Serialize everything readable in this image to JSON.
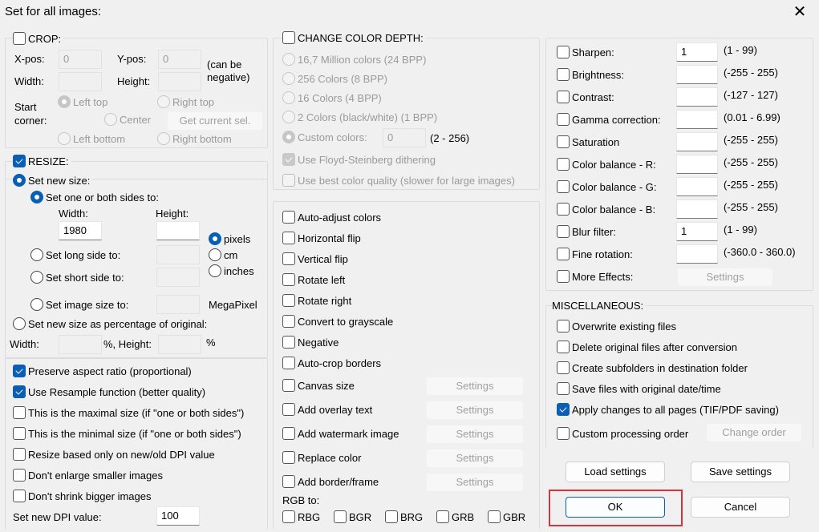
{
  "window": {
    "title": "Set for all images:",
    "close_icon": "close-icon"
  },
  "crop": {
    "label": "CROP:",
    "checked": false,
    "xpos_label": "X-pos:",
    "xpos_value": "0",
    "ypos_label": "Y-pos:",
    "ypos_value": "0",
    "can_be": "(can be",
    "negative": "negative)",
    "width_label": "Width:",
    "height_label": "Height:",
    "start_label1": "Start",
    "start_label2": "corner:",
    "left_top": "Left top",
    "right_top": "Right top",
    "center": "Center",
    "left_bottom": "Left bottom",
    "right_bottom": "Right bottom",
    "get_sel": "Get current sel."
  },
  "resize": {
    "label": "RESIZE:",
    "checked": true,
    "set_new_size": "Set new size:",
    "one_or_both": "Set one or both sides to:",
    "width_label": "Width:",
    "height_label": "Height:",
    "width_value": "1980",
    "height_value": "",
    "pixels": "pixels",
    "cm": "cm",
    "inches": "inches",
    "long_side": "Set long side to:",
    "short_side": "Set short side to:",
    "image_size": "Set image size to:",
    "megapixel": "MegaPixel",
    "percentage": "Set new size as percentage of original:",
    "pct_width": "Width:",
    "pct_height": "%, Height:",
    "pct": "%"
  },
  "resize_options": [
    {
      "label": "Preserve aspect ratio (proportional)",
      "checked": true
    },
    {
      "label": "Use Resample function (better quality)",
      "checked": true
    },
    {
      "label": "This is the maximal size (if \"one or both sides\")",
      "checked": false
    },
    {
      "label": "This is the minimal size (if \"one or both sides\")",
      "checked": false
    },
    {
      "label": "Resize based only on new/old DPI value",
      "checked": false
    },
    {
      "label": "Don't enlarge smaller images",
      "checked": false
    },
    {
      "label": "Don't shrink bigger images",
      "checked": false
    }
  ],
  "dpi": {
    "label": "Set new DPI value:",
    "value": "100"
  },
  "color_depth": {
    "label": "CHANGE COLOR DEPTH:",
    "checked": false,
    "options": [
      "16,7 Million colors (24 BPP)",
      "256 Colors (8 BPP)",
      "16 Colors (4 BPP)",
      "2 Colors (black/white) (1 BPP)"
    ],
    "custom": "Custom colors:",
    "custom_value": "0",
    "custom_range": "(2 - 256)",
    "floyd": "Use Floyd-Steinberg dithering",
    "best": "Use best color quality (slower for large images)"
  },
  "transforms": [
    "Auto-adjust colors",
    "Horizontal flip",
    "Vertical flip",
    "Rotate left",
    "Rotate right",
    "Convert to grayscale",
    "Negative",
    "Auto-crop borders"
  ],
  "settings_items": [
    "Canvas size",
    "Add overlay text",
    "Add watermark image",
    "Replace color",
    "Add border/frame"
  ],
  "settings_label": "Settings",
  "rgb": {
    "label": "RGB to:",
    "options": [
      "RBG",
      "BGR",
      "BRG",
      "GRB",
      "GBR"
    ]
  },
  "effects": [
    {
      "label": "Sharpen:",
      "value": "1",
      "range": "(1  -  99)"
    },
    {
      "label": "Brightness:",
      "value": "",
      "range": "(-255  -  255)"
    },
    {
      "label": "Contrast:",
      "value": "",
      "range": "(-127  -  127)"
    },
    {
      "label": "Gamma correction:",
      "value": "",
      "range": "(0.01  -  6.99)"
    },
    {
      "label": "Saturation",
      "value": "",
      "range": "(-255  -  255)"
    },
    {
      "label": "Color balance - R:",
      "value": "",
      "range": "(-255  -  255)"
    },
    {
      "label": "Color balance - G:",
      "value": "",
      "range": "(-255  -  255)"
    },
    {
      "label": "Color balance - B:",
      "value": "",
      "range": "(-255  -  255)"
    },
    {
      "label": "Blur filter:",
      "value": "1",
      "range": "(1  -  99)"
    },
    {
      "label": "Fine rotation:",
      "value": "",
      "range": "(-360.0  -  360.0)"
    }
  ],
  "more_effects": "More Effects:",
  "misc": {
    "label": "MISCELLANEOUS:",
    "items": [
      {
        "label": "Overwrite existing files",
        "checked": false
      },
      {
        "label": "Delete original files after conversion",
        "checked": false
      },
      {
        "label": "Create subfolders in destination folder",
        "checked": false
      },
      {
        "label": "Save files with original date/time",
        "checked": false
      },
      {
        "label": "Apply changes to all pages (TIF/PDF saving)",
        "checked": true
      }
    ],
    "custom_order": "Custom processing order",
    "change_order": "Change order"
  },
  "buttons": {
    "load": "Load settings",
    "save": "Save settings",
    "ok": "OK",
    "cancel": "Cancel"
  },
  "highlight_color": "#d8333c"
}
